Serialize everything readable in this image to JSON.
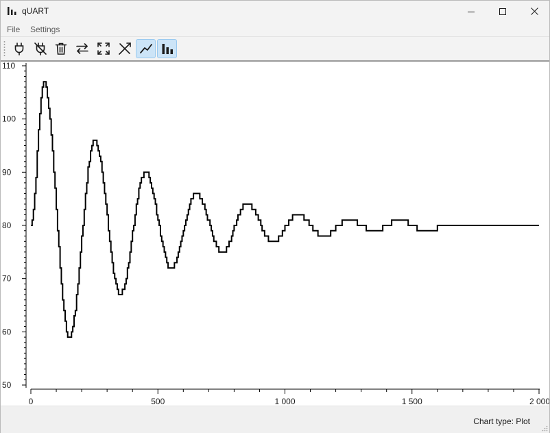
{
  "window": {
    "title": "qUART",
    "icon": "bar-chart-icon",
    "controls": {
      "minimize": "minimize-icon",
      "maximize": "maximize-icon",
      "close": "close-icon"
    }
  },
  "menu": {
    "items": [
      "File",
      "Settings"
    ]
  },
  "toolbar": {
    "tools": [
      {
        "icon": "plug-connect-icon",
        "active": false
      },
      {
        "icon": "plug-disconnect-icon",
        "active": false
      },
      {
        "icon": "trash-icon",
        "active": false
      },
      {
        "icon": "swap-arrows-icon",
        "active": false
      },
      {
        "icon": "fullscreen-icon",
        "active": false
      },
      {
        "icon": "autoscale-line-icon",
        "active": false
      },
      {
        "icon": "line-chart-icon",
        "active": true
      },
      {
        "icon": "bar-chart-icon",
        "active": true
      }
    ]
  },
  "chart_data": {
    "type": "line",
    "title": "",
    "xlabel": "",
    "ylabel": "",
    "xlim": [
      0,
      2000
    ],
    "ylim": [
      50,
      110
    ],
    "x_ticks": [
      0,
      500,
      1000,
      1500,
      2000
    ],
    "x_tick_labels": [
      "0",
      "500",
      "1 000",
      "1 500",
      "2 000"
    ],
    "y_ticks": [
      50,
      60,
      70,
      80,
      90,
      100,
      110
    ],
    "y_tick_labels": [
      "50",
      "60",
      "70",
      "80",
      "90",
      "100",
      "110"
    ],
    "grid": false,
    "legend": "none",
    "line_color": "#000000",
    "series": [
      {
        "x": [
          0,
          50,
          150,
          250,
          350,
          450,
          550,
          650,
          750,
          850,
          950,
          1050,
          1150,
          1250,
          1350,
          1450,
          1550,
          1650,
          2000
        ],
        "values": [
          80,
          107,
          59,
          96,
          67,
          90,
          72,
          86,
          75,
          84,
          77,
          82,
          78,
          81,
          79,
          81,
          79,
          80,
          80
        ]
      }
    ]
  },
  "status": {
    "text": "Chart type: Plot"
  }
}
